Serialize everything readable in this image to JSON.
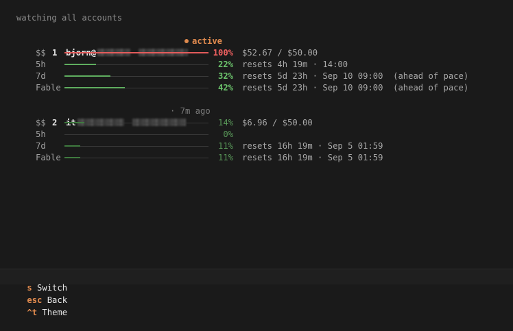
{
  "header": "watching all accounts",
  "accounts": [
    {
      "index": "1",
      "email_prefix": "bjorn@",
      "status": "active",
      "metrics": [
        {
          "label": "$$",
          "pct": "100%",
          "fraction": 1.0,
          "info": "$52.67 / $50.00",
          "kind": "over"
        },
        {
          "label": "5h",
          "pct": "22%",
          "fraction": 0.22,
          "info": "resets 4h 19m · 14:00",
          "kind": "ok"
        },
        {
          "label": "7d",
          "pct": "32%",
          "fraction": 0.32,
          "info": "resets 5d 23h · Sep 10 09:00  (ahead of pace)",
          "kind": "ok"
        },
        {
          "label": "Fable",
          "pct": "42%",
          "fraction": 0.42,
          "info": "resets 5d 23h · Sep 10 09:00  (ahead of pace)",
          "kind": "ok"
        }
      ]
    },
    {
      "index": "2",
      "email_prefix": "it",
      "status": "· 7m ago",
      "metrics": [
        {
          "label": "$$",
          "pct": "14%",
          "fraction": 0.14,
          "info": "$6.96 / $50.00",
          "kind": "dim"
        },
        {
          "label": "5h",
          "pct": "0%",
          "fraction": 0.0,
          "info": "",
          "kind": "dim"
        },
        {
          "label": "7d",
          "pct": "11%",
          "fraction": 0.11,
          "info": "resets 16h 19m · Sep 5 01:59",
          "kind": "dim"
        },
        {
          "label": "Fable",
          "pct": "11%",
          "fraction": 0.11,
          "info": "resets 16h 19m · Sep 5 01:59",
          "kind": "dim"
        }
      ]
    }
  ],
  "bottombar": [
    {
      "key": "s",
      "label": "Switch"
    },
    {
      "key": "esc",
      "label": "Back"
    },
    {
      "key": "^t",
      "label": "Theme"
    }
  ]
}
